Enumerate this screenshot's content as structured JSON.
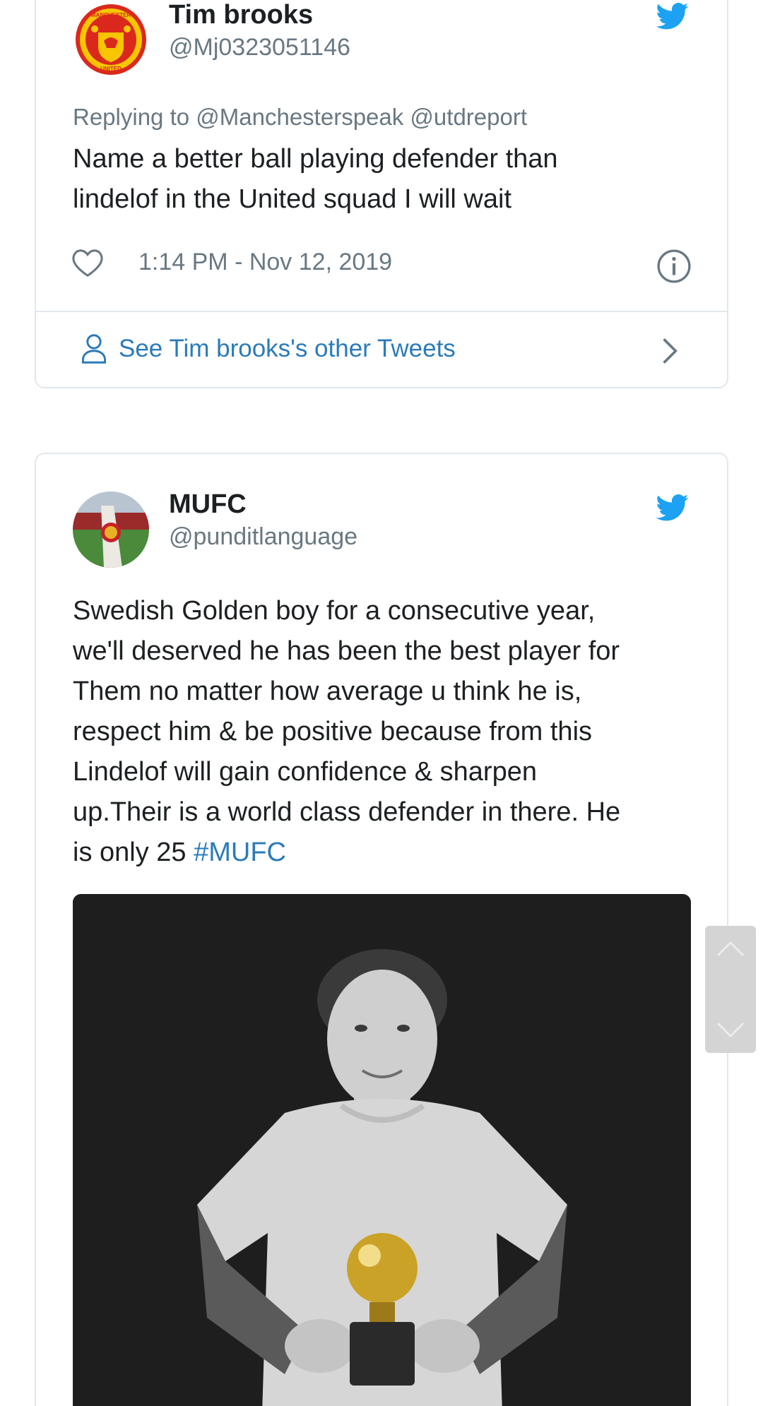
{
  "tweets": [
    {
      "author_name": "Tim brooks",
      "author_handle": "@Mj0323051146",
      "reply_prefix": "Replying to",
      "reply_handles": "@Manchesterspeak @utdreport",
      "text": "Name a better ball playing defender than\nlindelof in the United squad I will wait",
      "timestamp": "1:14 PM - Nov 12, 2019",
      "other_tweets_label": "See Tim brooks's other Tweets",
      "avatar_icon": "manchester-united-crest",
      "avatar_crest_top": "MANCHESTER",
      "avatar_crest_bottom": "UNITED"
    },
    {
      "author_name": "MUFC",
      "author_handle": "@punditlanguage",
      "text": "Swedish Golden boy for a consecutive year,\nwe'll deserved he has been the best player for\nThem no matter how average u think he is,\nrespect him & be positive because from this\nLindelof will gain confidence & sharpen\nup.Their is a world class defender in there. He\nis only 25 ",
      "hashtag": "#MUFC",
      "avatar_icon": "stadium-corner-flag-photo",
      "media_icon": "player-holding-golden-boy-trophy-photo"
    }
  ],
  "colors": {
    "link": "#2b7bb9",
    "secondary_text": "#697882",
    "twitter_blue": "#1da1f2",
    "border": "#e1e8ed"
  }
}
